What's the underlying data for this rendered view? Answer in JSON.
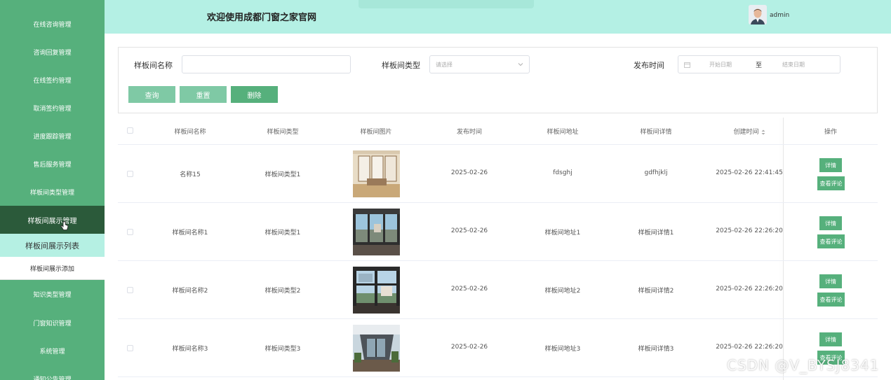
{
  "header": {
    "title": "欢迎使用成都门窗之家官网",
    "username": "admin"
  },
  "sidebar": {
    "items_top": [
      "在线咨询管理",
      "咨询回复管理",
      "在线签约管理",
      "取消签约管理",
      "进度跟踪管理",
      "售后服务管理",
      "样板间类型管理"
    ],
    "active": "样板间展示管理",
    "sub_selected": "样板间展示列表",
    "sub_plain": "样板间展示添加",
    "items_bottom": [
      "知识类型管理",
      "门窗知识管理",
      "系统管理",
      "通知公告管理"
    ]
  },
  "search": {
    "name_label": "样板间名称",
    "name_value": "",
    "type_label": "样板间类型",
    "type_placeholder": "请选择",
    "date_label": "发布时间",
    "date_start_placeholder": "开始日期",
    "date_separator": "至",
    "date_end_placeholder": "结束日期",
    "query_label": "查询",
    "reset_label": "重置",
    "delete_label": "删除"
  },
  "table": {
    "columns": [
      "样板间名称",
      "样板间类型",
      "样板间图片",
      "发布时间",
      "样板间地址",
      "样板间详情",
      "创建时间",
      "操作"
    ],
    "rows": [
      {
        "name": "名称15",
        "type": "样板间类型1",
        "date": "2025-02-26",
        "address": "fdsghj",
        "detail": "gdfhjklj",
        "created": "2025-02-26 22:41:45"
      },
      {
        "name": "样板间名称1",
        "type": "样板间类型1",
        "date": "2025-02-26",
        "address": "样板间地址1",
        "detail": "样板间详情1",
        "created": "2025-02-26 22:26:20"
      },
      {
        "name": "样板间名称2",
        "type": "样板间类型2",
        "date": "2025-02-26",
        "address": "样板间地址2",
        "detail": "样板间详情2",
        "created": "2025-02-26 22:26:20"
      },
      {
        "name": "样板间名称3",
        "type": "样板间类型3",
        "date": "2025-02-26",
        "address": "样板间地址3",
        "detail": "样板间详情3",
        "created": "2025-02-26 22:26:20"
      }
    ],
    "detail_button": "详情",
    "comment_button": "查看评论"
  },
  "watermark": "CSDN @V_BYSJ8341",
  "colors": {
    "sidebar": "#56b07c",
    "sidebar_active": "#2b5a3a",
    "header": "#b4f0e4",
    "button": "#56b07c",
    "button_light": "#7fc9a5"
  }
}
